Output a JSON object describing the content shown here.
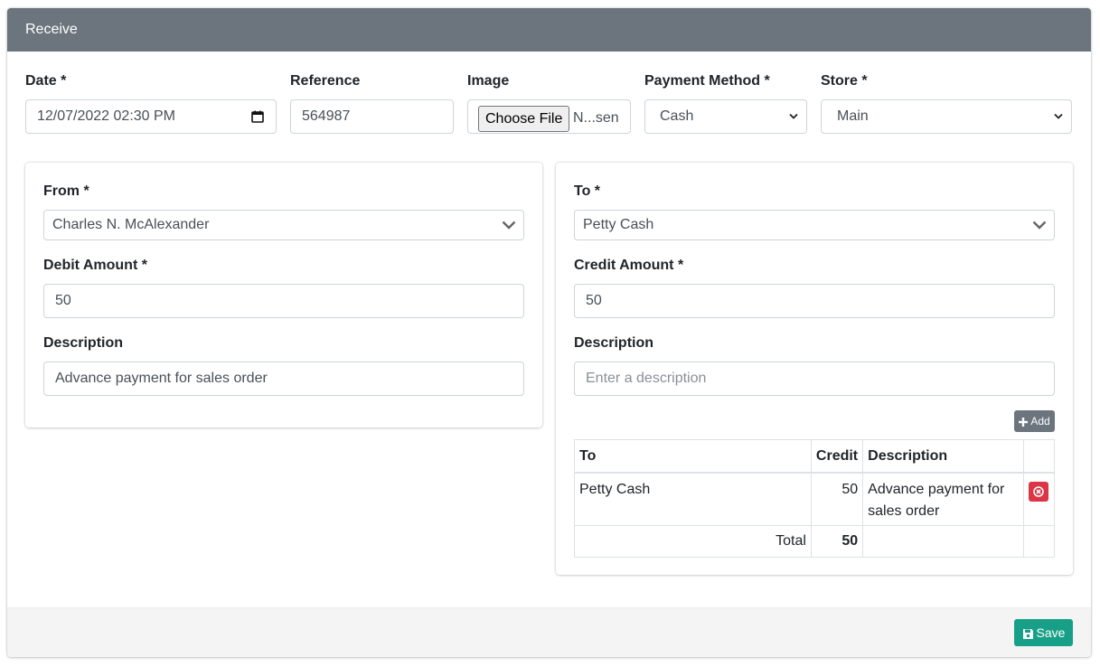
{
  "header": {
    "title": "Receive"
  },
  "top_fields": {
    "date": {
      "label": "Date *",
      "value": "12/07/2022 02:30 PM"
    },
    "reference": {
      "label": "Reference",
      "value": "564987"
    },
    "image": {
      "label": "Image",
      "button_label": "Choose File",
      "file_name": "N...sen"
    },
    "payment_method": {
      "label": "Payment Method *",
      "value": "Cash"
    },
    "store": {
      "label": "Store *",
      "value": "Main"
    }
  },
  "from_panel": {
    "from_label": "From *",
    "from_value": "Charles N. McAlexander",
    "amount_label": "Debit Amount *",
    "amount_value": "50",
    "description_label": "Description",
    "description_value": "Advance payment for sales order"
  },
  "to_panel": {
    "to_label": "To *",
    "to_value": "Petty Cash",
    "amount_label": "Credit Amount *",
    "amount_value": "50",
    "description_label": "Description",
    "description_placeholder": "Enter a description",
    "add_label": "Add"
  },
  "lines_table": {
    "headers": {
      "to": "To",
      "credit": "Credit",
      "description": "Description"
    },
    "rows": [
      {
        "to": "Petty Cash",
        "credit": "50",
        "description": "Advance payment for sales order"
      }
    ],
    "total_label": "Total",
    "total_value": "50"
  },
  "footer": {
    "save_label": "Save"
  },
  "colors": {
    "header": "#6c757d",
    "save": "#17a087",
    "delete": "#dc3545",
    "add": "#6c757d"
  }
}
